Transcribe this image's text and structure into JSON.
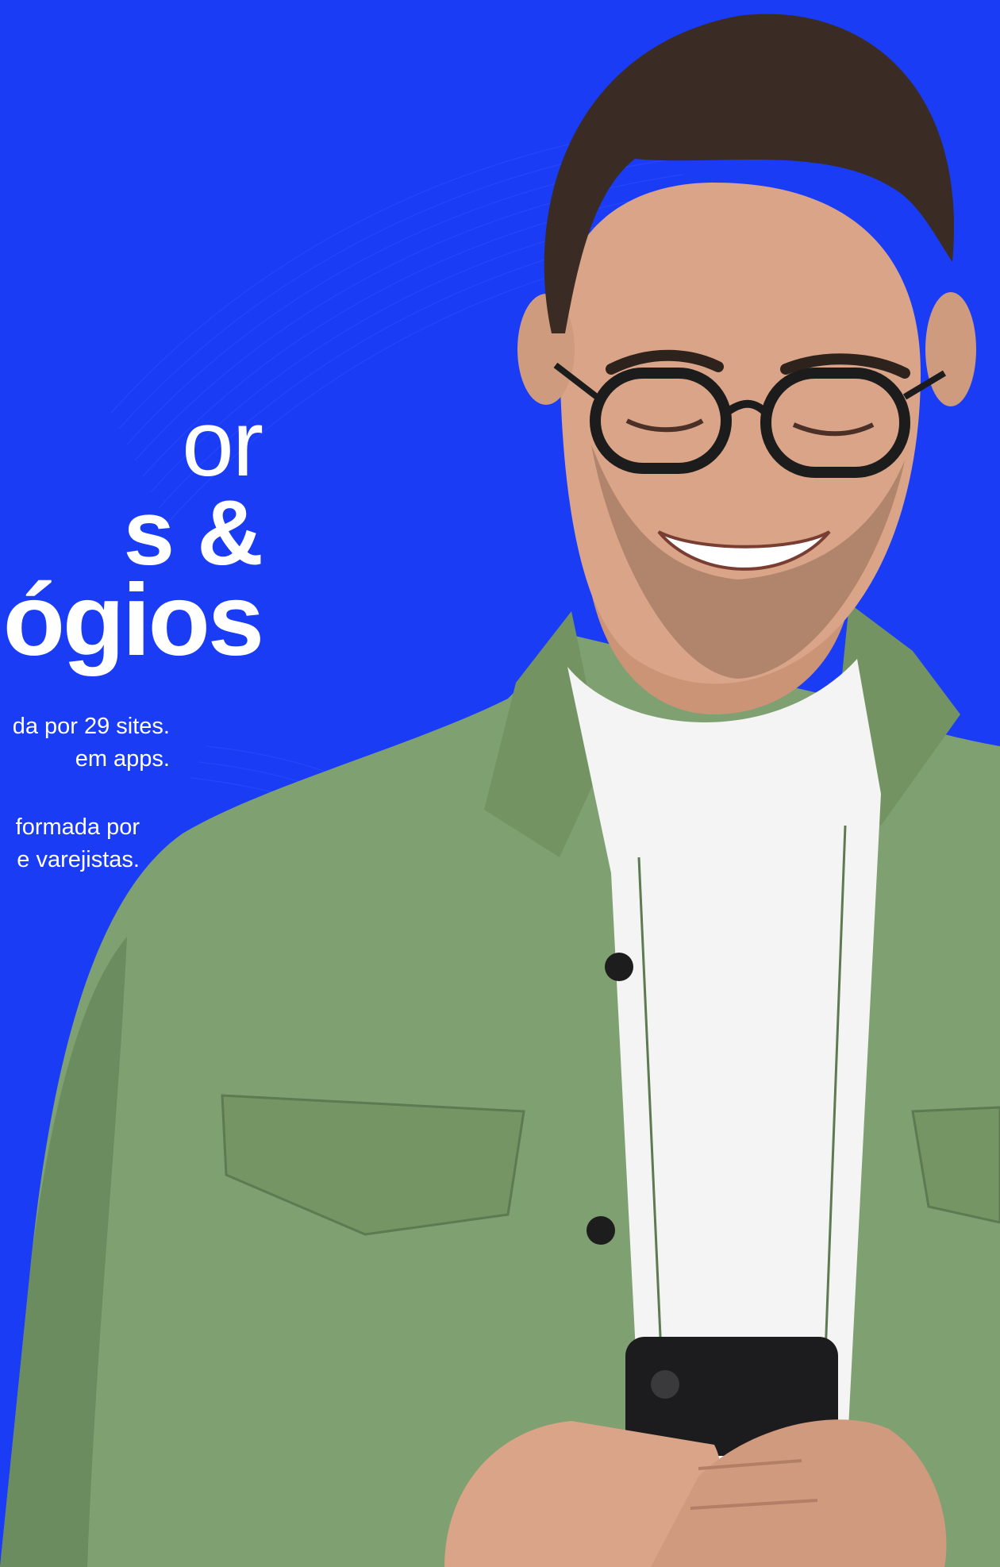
{
  "hero": {
    "headline": {
      "line1": "or",
      "line2": "s &",
      "line3": "ógios"
    },
    "paragraph_a": {
      "line1": "da por 29 sites.",
      "line2": "em apps."
    },
    "paragraph_b": {
      "line1": "formada por",
      "line2": "e varejistas."
    }
  },
  "colors": {
    "background": "#1a3cf5",
    "text": "#ffffff",
    "jacket": "#7fa071",
    "shirt": "#f4f4f4",
    "skin": "#d9a488",
    "hair": "#3a2c24",
    "phone": "#1c1c1e"
  },
  "image": {
    "subject": "smiling man with glasses in green overshirt looking at smartphone"
  }
}
